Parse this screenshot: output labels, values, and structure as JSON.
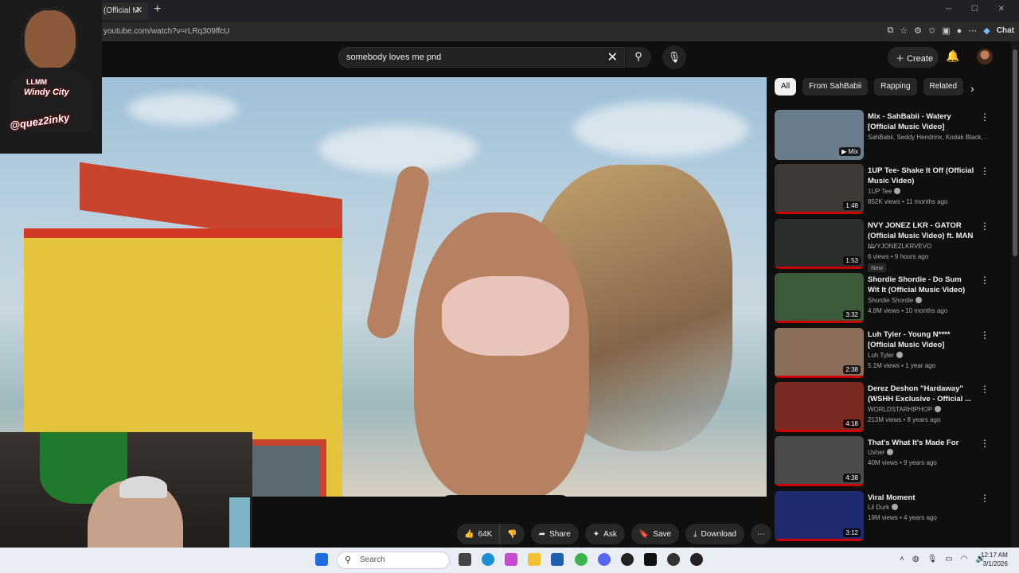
{
  "browser": {
    "tab_title": "(Official M",
    "tab_close": "✕",
    "new_tab": "+",
    "url": "youtube.com/watch?v=rLRq309ffcU",
    "chat_label": "Chat"
  },
  "header": {
    "search_value": "somebody loves me pnd",
    "create_label": "Create"
  },
  "streamer": {
    "logo_line1": "LLMM",
    "logo_line2": "Windy City",
    "logo_handle": "@quez2inky"
  },
  "actions": {
    "like_count": "64K",
    "share_label": "Share",
    "ask_label": "Ask",
    "save_label": "Save",
    "download_label": "Download"
  },
  "chips": [
    "All",
    "From SahBabii",
    "Rapping",
    "Related"
  ],
  "videos": [
    {
      "title": "Mix - SahBabii - Watery [Official Music Video]",
      "channel": "SahBabii, Seddy Hendrinx, Kodak Black, ...",
      "meta": "",
      "duration": "▶ Mix",
      "verified": false,
      "badge": "",
      "thumb": "#6b7d8a"
    },
    {
      "title": "1UP Tee- Shake It Off (Official Music Video)",
      "channel": "1UP Tee",
      "meta": "852K views • 11 months ago",
      "duration": "1:48",
      "verified": true,
      "badge": "",
      "thumb": "#3d3a35"
    },
    {
      "title": "NVY JONEZ LKR - GATOR (Official Music Video) ft. MAN ...",
      "channel": "NVYJONEZLKRVEVO",
      "meta": "6 views • 9 hours ago",
      "duration": "1:53",
      "verified": false,
      "badge": "New",
      "thumb": "#2a2f2e"
    },
    {
      "title": "Shordie Shordie - Do Sum Wit It (Official Music Video)",
      "channel": "Shordie Shordie",
      "meta": "4.8M views • 10 months ago",
      "duration": "3:32",
      "verified": true,
      "badge": "",
      "thumb": "#3d5a3a"
    },
    {
      "title": "Luh Tyler - Young N**** [Official Music Video]",
      "channel": "Luh Tyler",
      "meta": "5.1M views • 1 year ago",
      "duration": "2:38",
      "verified": true,
      "badge": "",
      "thumb": "#8a6e5a"
    },
    {
      "title": "Derez Deshon \"Hardaway\" (WSHH Exclusive - Official ...",
      "channel": "WORLDSTARHIPHOP",
      "meta": "213M views • 8 years ago",
      "duration": "4:18",
      "verified": true,
      "badge": "",
      "thumb": "#7a2a20"
    },
    {
      "title": "That's What It's Made For",
      "channel": "Usher",
      "meta": "40M views • 9 years ago",
      "duration": "4:38",
      "verified": true,
      "badge": "",
      "thumb": "#4a4a4a"
    },
    {
      "title": "Viral Moment",
      "channel": "Lil Durk",
      "meta": "19M views • 4 years ago",
      "duration": "3:12",
      "verified": true,
      "badge": "",
      "thumb": "#1f2a70"
    }
  ],
  "taskbar": {
    "search_placeholder": "Search",
    "time": "12:17 AM",
    "date": "3/1/2026"
  }
}
